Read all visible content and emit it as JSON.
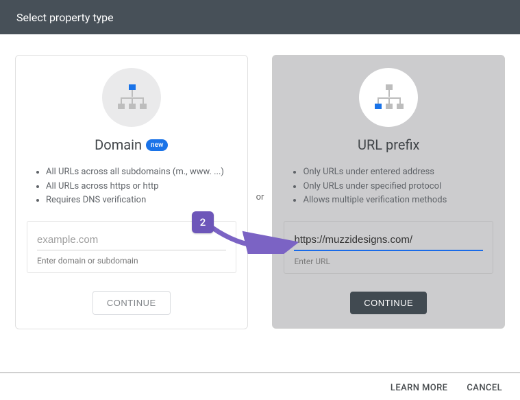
{
  "header": {
    "title": "Select property type"
  },
  "separator": "or",
  "domain_card": {
    "title": "Domain",
    "new_badge": "new",
    "features": [
      "All URLs across all subdomains (m., www. ...)",
      "All URLs across https or http",
      "Requires DNS verification"
    ],
    "input": {
      "placeholder": "example.com",
      "value": "",
      "helper": "Enter domain or subdomain"
    },
    "continue": "CONTINUE"
  },
  "urlprefix_card": {
    "title": "URL prefix",
    "features": [
      "Only URLs under entered address",
      "Only URLs under specified protocol",
      "Allows multiple verification methods"
    ],
    "input": {
      "placeholder": "",
      "value": "https://muzzidesigns.com/",
      "helper": "Enter URL"
    },
    "continue": "CONTINUE"
  },
  "footer": {
    "learn_more": "LEARN MORE",
    "cancel": "CANCEL"
  },
  "annotation": {
    "step_number": "2"
  },
  "colors": {
    "accent": "#1a73e8",
    "header_bg": "#475058",
    "annotation": "#6d56b9"
  }
}
